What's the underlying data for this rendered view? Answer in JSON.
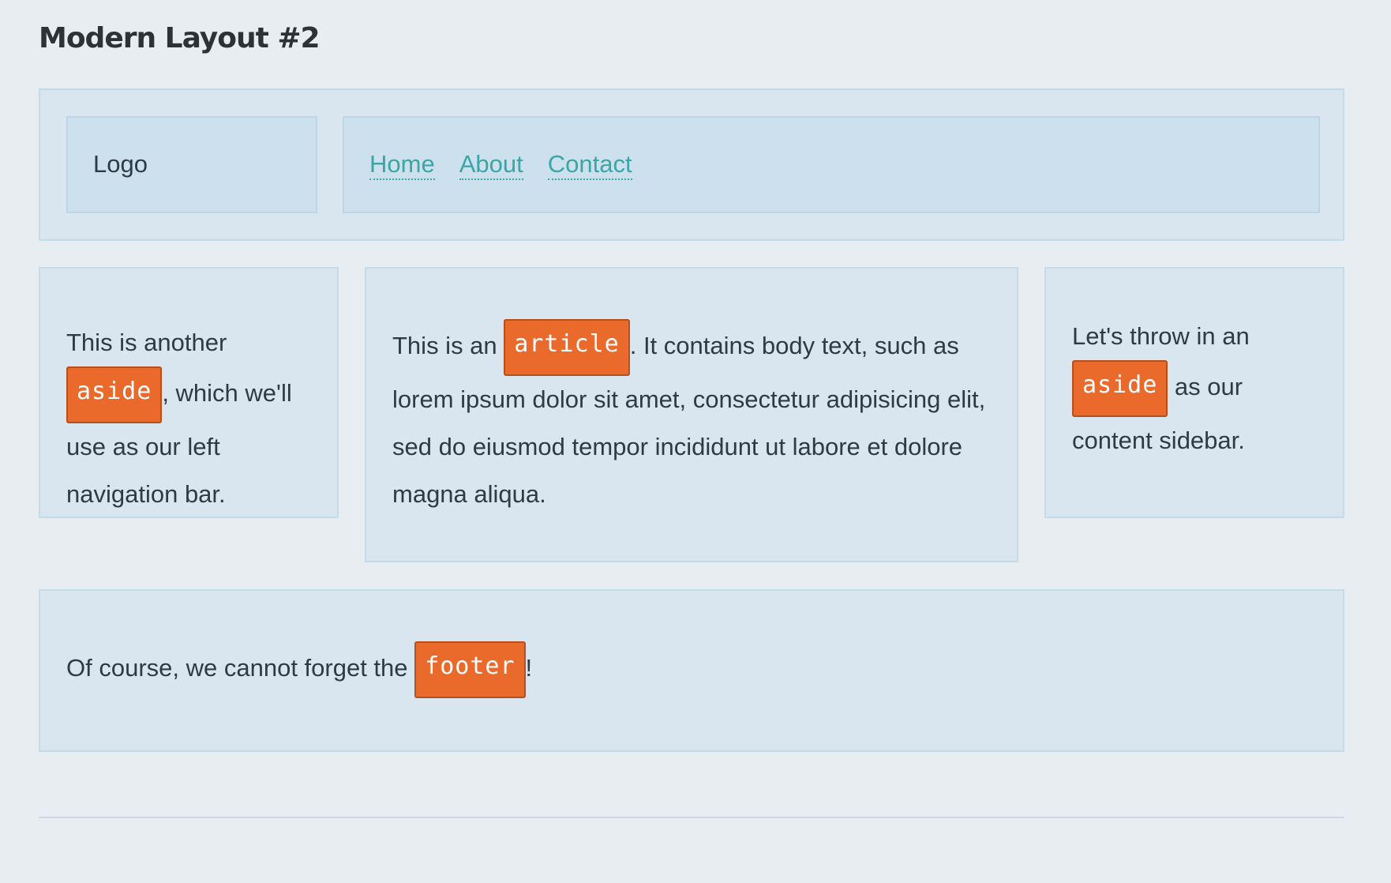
{
  "page": {
    "title": "Modern Layout #2"
  },
  "header": {
    "logo": "Logo",
    "nav": [
      {
        "label": "Home"
      },
      {
        "label": "About"
      },
      {
        "label": "Contact"
      }
    ]
  },
  "left_aside": {
    "before": "This is another ",
    "tag": "aside",
    "after": ", which we'll use as our left navigation bar."
  },
  "article": {
    "before": "This is an ",
    "tag": "article",
    "after": ". It contains body text, such as lorem ipsum dolor sit amet, consectetur adipisicing elit, sed do eiusmod tempor incididunt ut labore et dolore magna aliqua."
  },
  "right_aside": {
    "before": "Let's throw in an ",
    "tag": "aside",
    "after": " as our content sidebar."
  },
  "footer": {
    "before": "Of course, we cannot forget the ",
    "tag": "footer",
    "after": "!"
  },
  "colors": {
    "background": "#e8edf1",
    "panel": "#d9e6ef",
    "link": "#3aa6a6",
    "tag": "#ea6a2c"
  }
}
